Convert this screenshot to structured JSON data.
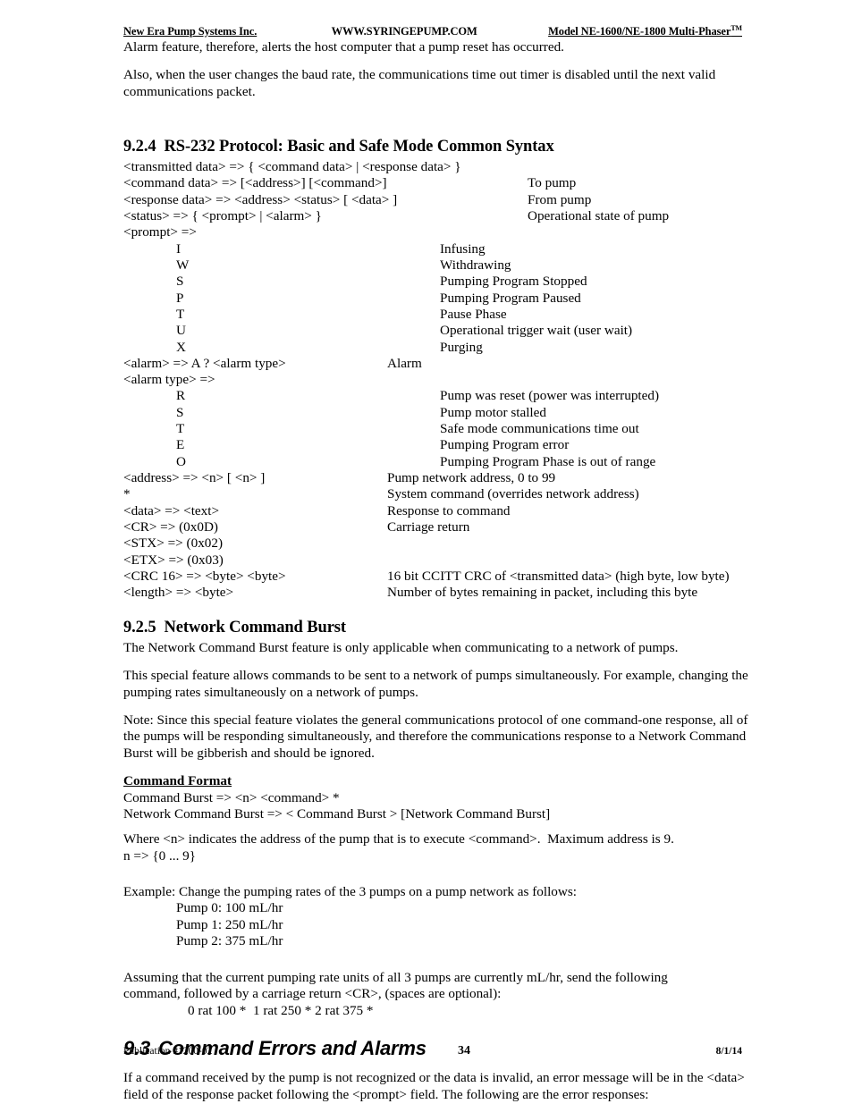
{
  "header": {
    "left": "New Era Pump Systems Inc.",
    "center": "WWW.SYRINGEPUMP.COM",
    "right": "Model NE-1600/NE-1800 Multi-Phaser",
    "right_suffix": "TM"
  },
  "intro": {
    "para1": "Alarm feature, therefore, alerts the host computer that a pump reset has occurred.",
    "para2": "Also, when the user changes the baud rate, the communications time out timer is disabled until the next valid communications packet."
  },
  "section_924": {
    "number": "9.2.4",
    "title": "RS-232 Protocol:  Basic and Safe Mode Common Syntax",
    "syntax_rows": [
      {
        "term": "<transmitted data> => { <command data> | <response data> }",
        "desc": ""
      },
      {
        "term": "<command data> => [<address>] [<command>]",
        "desc": "To pump"
      },
      {
        "term": "<response data> => <address> <status> [ <data> ]",
        "desc": "From pump"
      },
      {
        "term": "<status> => { <prompt> | <alarm> }",
        "desc": "Operational state of pump"
      },
      {
        "term": "<prompt> =>",
        "desc": ""
      }
    ],
    "prompt_codes": [
      {
        "code": "I",
        "desc": "Infusing"
      },
      {
        "code": "W",
        "desc": "Withdrawing"
      },
      {
        "code": "S",
        "desc": "Pumping Program Stopped"
      },
      {
        "code": "P",
        "desc": "Pumping Program Paused"
      },
      {
        "code": "T",
        "desc": "Pause Phase"
      },
      {
        "code": "U",
        "desc": "Operational trigger wait (user wait)"
      },
      {
        "code": "X",
        "desc": "Purging"
      }
    ],
    "alarm_row": {
      "term": "<alarm> => A ? <alarm type>",
      "desc": "Alarm"
    },
    "alarm_type_row": {
      "term": "<alarm type> =>",
      "desc": ""
    },
    "alarm_codes": [
      {
        "code": "R",
        "desc": "Pump was reset (power was interrupted)"
      },
      {
        "code": "S",
        "desc": "Pump motor stalled"
      },
      {
        "code": "T",
        "desc": "Safe mode communications time out"
      },
      {
        "code": "E",
        "desc": "Pumping Program error"
      },
      {
        "code": "O",
        "desc": "Pumping Program Phase is out of range"
      }
    ],
    "definitions": [
      {
        "term": "<address> => <n> [ <n> ]",
        "desc": "Pump network address, 0 to 99"
      },
      {
        "term": "*",
        "desc": "System command (overrides network address)"
      },
      {
        "term": "<data> => <text>",
        "desc": "Response to command"
      },
      {
        "term": "<CR> => (0x0D)",
        "desc": "Carriage return"
      },
      {
        "term": "<STX> => (0x02)",
        "desc": ""
      },
      {
        "term": "<ETX> => (0x03)",
        "desc": ""
      },
      {
        "term": "<CRC 16> => <byte> <byte>",
        "desc": "16 bit CCITT CRC of <transmitted data> (high byte, low byte)"
      },
      {
        "term": "<length> => <byte>",
        "desc": "Number of bytes remaining in packet, including this byte"
      }
    ]
  },
  "section_925": {
    "number": "9.2.5",
    "title": "Network Command Burst",
    "para1": "The Network Command Burst feature is only applicable when communicating to a network of pumps.",
    "para2": "This special feature allows commands to be sent to a network of pumps simultaneously.  For example, changing the pumping rates simultaneously on a network of pumps.",
    "para3": "Note:  Since this special feature violates the general communications protocol of one command-one response, all of the pumps will be responding simultaneously, and therefore the communications response to a Network Command Burst will be gibberish and should be ignored.",
    "command_format_heading": "Command Format",
    "format_line1": "Command Burst => <n> <command> *",
    "format_line2": "Network Command Burst => < Command Burst > [Network Command Burst]",
    "where_line1": "Where <n> indicates the address of the pump that is to execute <command>.  Maximum address is 9.",
    "where_line2": "n => {0 ... 9}",
    "example_intro": "Example: Change the pumping rates of the 3 pumps on a pump network as follows:",
    "example_pumps": [
      "Pump 0: 100 mL/hr",
      "Pump 1: 250 mL/hr",
      "Pump 2: 375 mL/hr"
    ],
    "assuming_line1": "Assuming that the current pumping rate units of all 3 pumps are currently mL/hr, send the following",
    "assuming_line2": "command, followed by a carriage return <CR>, (spaces are optional):",
    "example_command": "0 rat 100 *  1 rat 250 * 2 rat 375 *"
  },
  "section_93": {
    "number": "9.3",
    "title": "Command Errors and Alarms",
    "para1": "If a command received by the pump is not recognized or the data is invalid, an error message will be in the <data> field of the response packet following the <prompt> field.  The following are the error responses:"
  },
  "footer": {
    "left": "Publication #1200-02",
    "center": "34",
    "right": "8/1/14"
  }
}
